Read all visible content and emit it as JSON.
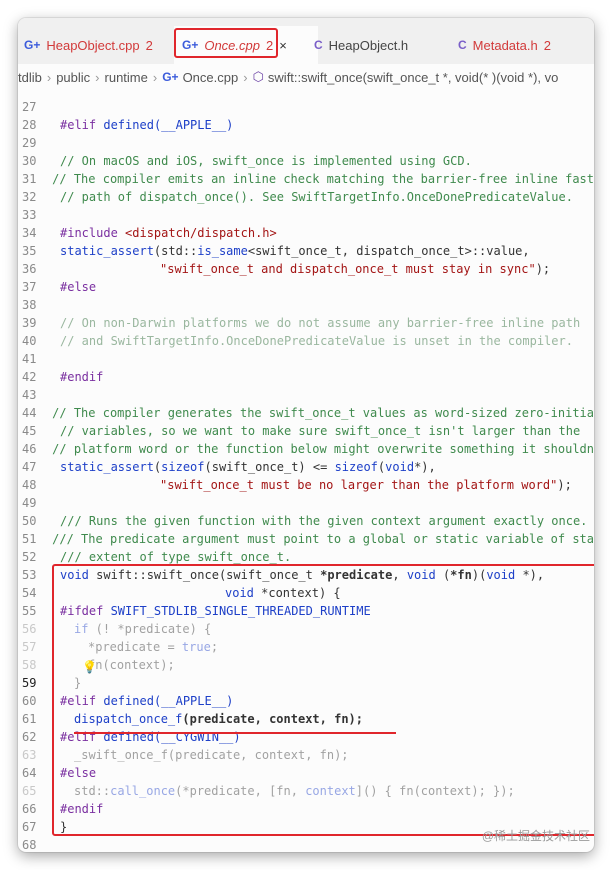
{
  "tabs": [
    {
      "icon": "G+",
      "name": "HeapObject.cpp",
      "badge": "2",
      "active": false
    },
    {
      "icon": "G+",
      "name": "Once.cpp",
      "badge": "2",
      "active": true,
      "close": "×"
    },
    {
      "icon": "C",
      "name": "HeapObject.h",
      "badge": "",
      "active": false
    },
    {
      "icon": "C",
      "name": "Metadata.h",
      "badge": "2",
      "active": false
    }
  ],
  "breadcrumb": {
    "items": [
      "tdlib",
      "public",
      "runtime"
    ],
    "file_icon": "G+",
    "file": "Once.cpp",
    "symbol_icon": "⬡",
    "symbol": "swift::swift_once(swift_once_t *, void(* )(void *), vo"
  },
  "code": {
    "l27": "",
    "l28_a": "#elif",
    "l28_b": "defined",
    "l28_c": "(__APPLE__)",
    "l30": "// On macOS and iOS, swift_once is implemented using GCD.",
    "l31": "// The compiler emits an inline check matching the barrier-free inline fast",
    "l32": "// path of dispatch_once(). See SwiftTargetInfo.OnceDonePredicateValue.",
    "l34_a": "#include",
    "l34_b": "<dispatch/dispatch.h>",
    "l35_a": "static_assert",
    "l35_b": "(std::",
    "l35_c": "is_same",
    "l35_d": "<swift_once_t, dispatch_once_t>",
    "l35_e": "::value,",
    "l36": "\"swift_once_t and dispatch_once_t must stay in sync\"",
    "l36_end": ");",
    "l37": "#else",
    "l39": "// On non-Darwin platforms we do not assume any barrier-free inline path",
    "l40": "// and SwiftTargetInfo.OnceDonePredicateValue is unset in the compiler.",
    "l42": "#endif",
    "l44": "// The compiler generates the swift_once_t values as word-sized zero-initia",
    "l45": "// variables, so we want to make sure swift_once_t isn't larger than the",
    "l46": "// platform word or the function below might overwrite something it shouldn",
    "l47_a": "static_assert",
    "l47_b": "(",
    "l47_c": "sizeof",
    "l47_d": "(swift_once_t) <= ",
    "l47_e": "sizeof",
    "l47_f": "(",
    "l47_g": "void",
    "l47_h": "*),",
    "l48": "\"swift_once_t must be no larger than the platform word\"",
    "l48_end": ");",
    "l50": "/// Runs the given function with the given context argument exactly once.",
    "l51": "/// The predicate argument must point to a global or static variable of sta",
    "l52": "/// extent of type swift_once_t.",
    "l53_a": "void",
    "l53_b": " swift::",
    "l53_c": "swift_once",
    "l53_d": "(swift_once_t ",
    "l53_e": "*predicate",
    "l53_f": ", ",
    "l53_g": "void",
    "l53_h": " (",
    "l53_i": "*fn",
    "l53_j": ")(",
    "l53_k": "void",
    "l53_l": " *),",
    "l54_a": "void",
    "l54_b": " *context",
    "l54_c": ") {",
    "l55_a": "#ifdef",
    "l55_b": " SWIFT_STDLIB_SINGLE_THREADED_RUNTIME",
    "l56_a": "if",
    "l56_b": " (! *predicate) {",
    "l57_a": "*predicate = ",
    "l57_b": "true",
    "l57_c": ";",
    "l58": "fn(context);",
    "l59": "}",
    "l60_a": "#elif",
    "l60_b": "defined",
    "l60_c": "(__APPLE__)",
    "l61_a": "dispatch_once_f",
    "l61_b": "(predicate, context, fn);",
    "l62_a": "#elif",
    "l62_b": "defined",
    "l62_c": "(__CYGWIN__)",
    "l63": "_swift_once_f(predicate, context, fn);",
    "l64": "#else",
    "l65_a": "std::",
    "l65_b": "call_once",
    "l65_c": "(*predicate, [fn, ",
    "l65_d": "context",
    "l65_e": "]() { fn(context); });",
    "l66": "#endif",
    "l67": "}",
    "l68": ""
  },
  "line_numbers": [
    "27",
    "28",
    "29",
    "30",
    "31",
    "32",
    "33",
    "34",
    "35",
    "36",
    "37",
    "38",
    "39",
    "40",
    "41",
    "42",
    "43",
    "44",
    "45",
    "46",
    "47",
    "48",
    "49",
    "50",
    "51",
    "52",
    "53",
    "54",
    "55",
    "56",
    "57",
    "58",
    "59",
    "60",
    "61",
    "62",
    "63",
    "64",
    "65",
    "66",
    "67",
    "68"
  ],
  "watermark": "@稀土掘金技术社区",
  "colors": {
    "highlight": "#e0262c",
    "keyword": "#1e40c8",
    "preprocessor": "#7a2fa0",
    "string": "#a31515",
    "comment": "#3f8a4d",
    "error": "#d23a3a"
  },
  "icons": {
    "cpp_file": "cpp-file-icon",
    "header_file": "c-header-icon",
    "symbol": "method-symbol-icon",
    "lightbulb": "lightbulb-icon"
  }
}
